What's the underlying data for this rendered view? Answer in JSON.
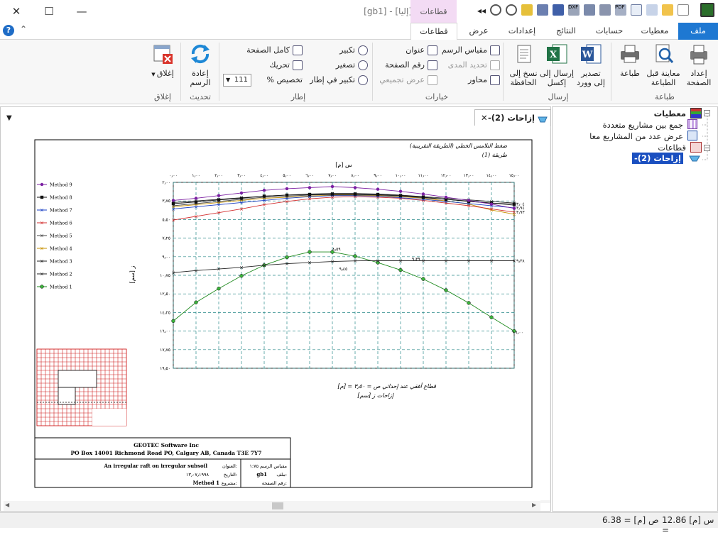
{
  "window": {
    "title": "[gb1] - [إليا]",
    "context_tab": "قطاعات"
  },
  "tabs": [
    {
      "id": "file",
      "label": "ملف"
    },
    {
      "id": "data",
      "label": "معطيات"
    },
    {
      "id": "calc",
      "label": "حسابات"
    },
    {
      "id": "results",
      "label": "النتائج"
    },
    {
      "id": "settings",
      "label": "إعدادات"
    },
    {
      "id": "view",
      "label": "عرض"
    },
    {
      "id": "sections",
      "label": "قطاعات"
    }
  ],
  "ribbon": {
    "print_group": {
      "label": "طباعة",
      "print_setup": "إعداد\nالصفحة",
      "print_preview": "معاينة قبل\nالطباعة",
      "print": "طباعة"
    },
    "send_group": {
      "label": "إرسال",
      "export_word": "تصدير\nإلى وورد",
      "send_excel": "إرسال إلى\nإكسل",
      "copy_clipboard": "نسخ إلى\nالحافظة"
    },
    "options_group": {
      "label": "خيارات",
      "scale": "مقياس الرسم",
      "title": "عنوان",
      "range": "تحديد المدى",
      "page_number": "رقم الصفحة",
      "axes": "محاور",
      "summary_view": "عرض تجميعي"
    },
    "frame_group": {
      "label": "إطار",
      "zoom_in": "تكبير",
      "full_page": "كامل الصفحة",
      "zoom_out": "تصغير",
      "pan": "تحريك",
      "zoom_window": "تكبير في إطار",
      "custom": "تخصيص %",
      "custom_value": "111"
    },
    "refresh_group": {
      "label": "تحديث",
      "redraw": "إعادة\nالرسم"
    },
    "close_group": {
      "label": "إغلاق",
      "close": "إغلاق"
    }
  },
  "document_tab": {
    "label": "إزاحات (2)-"
  },
  "tree": {
    "root": "معطيات",
    "items": [
      "جمع بين مشاريع متعددة",
      "عرض عدد من المشاريع معا"
    ],
    "sections": "قطاعات",
    "selected": "إزاحات (2)-"
  },
  "drawing": {
    "title_line1": "ضغط التلامس الخطي (الطريقة التقريبية)",
    "title_line2": "طريقة (1)",
    "x_axis_title": "س [م]",
    "y_axis_title": "ز [سم]",
    "footer_line1": "قطاع أفقي عند إحداثي ص = ٣٫٥٠ = [م]",
    "footer_line2": "إزاحات ز [سم]",
    "legend": [
      "Method 9",
      "Method 8",
      "Method 7",
      "Method 6",
      "Method 5",
      "Method 4",
      "Method 3",
      "Method 2",
      "Method 1"
    ],
    "company": "GEOTEC Software Inc",
    "address": "PO Box 14001 Richmond Road PO, Calgary AB, Canada T3E 7Y7",
    "project": "An irregular raft on irregular subsoil",
    "label_title": "العنوان:",
    "label_date": "التاريخ:",
    "date": "١٣٫٠٧٫١٩٩٨",
    "label_project": "مشروع:",
    "method": "Method 1",
    "label_scale": "مقياس الرسم ١:٧٥",
    "label_file": "ملف:",
    "file": "gb1",
    "label_page": "رقم الصفحة:"
  },
  "chart_data": {
    "type": "line",
    "x": [
      0,
      1,
      2,
      3,
      4,
      5,
      6,
      7,
      8,
      9,
      10,
      11,
      12,
      13,
      14,
      15
    ],
    "x_tick_labels": [
      "٠٫٠٠",
      "١٫٠٠",
      "٢٫٠٠",
      "٣٫٠٠",
      "٤٫٠٠",
      "٥٫٠٠",
      "٦٫٠٠",
      "٧٫٠٠",
      "٨٫٠٠",
      "٩٫٠٠",
      "١٠٫٠٠",
      "١١٫٠٠",
      "١٢٫٠٠",
      "١٣٫٠٠",
      "١٤٫٠٠",
      "١٥٫٠٠"
    ],
    "y_tick_labels": [
      "٢٫٠٠",
      "٣٫٧٥",
      "٥٫٥٠",
      "٧٫٢٥",
      "٩٫٠٠",
      "١٠٫٧٥",
      "١٢٫٥٠",
      "١٤٫٢٥",
      "١٦٫٠٠",
      "١٧٫٧٥",
      "١٩٫٥٠"
    ],
    "y_ticks": [
      2.0,
      3.75,
      5.5,
      7.25,
      9.0,
      10.75,
      12.5,
      14.25,
      16.0,
      17.75,
      19.5
    ],
    "ylim": [
      2.0,
      19.5
    ],
    "y_inverted": true,
    "series": [
      {
        "name": "Method 9",
        "color": "#7b1fa2",
        "values": [
          3.7,
          3.5,
          3.25,
          3.0,
          2.75,
          2.6,
          2.5,
          2.4,
          2.5,
          2.65,
          2.85,
          3.1,
          3.4,
          3.7,
          4.05,
          4.45
        ]
      },
      {
        "name": "Method 8",
        "color": "#111111",
        "values": [
          4.0,
          3.85,
          3.65,
          3.5,
          3.3,
          3.2,
          3.15,
          3.1,
          3.1,
          3.15,
          3.25,
          3.4,
          3.6,
          3.8,
          3.95,
          4.05
        ]
      },
      {
        "name": "Method 7",
        "color": "#1a3fc4",
        "values": [
          4.5,
          4.3,
          4.1,
          3.9,
          3.7,
          3.5,
          3.35,
          3.25,
          3.25,
          3.3,
          3.45,
          3.6,
          3.8,
          4.0,
          4.2,
          4.4
        ]
      },
      {
        "name": "Method 6",
        "color": "#d32f2f",
        "values": [
          5.55,
          5.2,
          4.85,
          4.5,
          4.1,
          3.8,
          3.55,
          3.4,
          3.35,
          3.4,
          3.5,
          3.7,
          3.95,
          4.2,
          4.5,
          4.8
        ]
      },
      {
        "name": "Method 5",
        "color": "#444444",
        "values": [
          4.2,
          4.0,
          3.8,
          3.6,
          3.4,
          3.3,
          3.2,
          3.15,
          3.15,
          3.2,
          3.3,
          3.45,
          3.6,
          3.75,
          3.95,
          4.15
        ]
      },
      {
        "name": "Method 4",
        "color": "#c79100",
        "values": [
          4.3,
          4.1,
          3.9,
          3.7,
          3.5,
          3.4,
          3.3,
          3.2,
          3.2,
          3.25,
          3.35,
          3.5,
          3.75,
          4.05,
          4.6,
          5.0
        ]
      },
      {
        "name": "Method 3",
        "color": "#222222",
        "values": [
          3.9,
          3.75,
          3.6,
          3.45,
          3.3,
          3.2,
          3.1,
          3.05,
          3.05,
          3.1,
          3.2,
          3.35,
          3.5,
          3.65,
          3.8,
          3.95
        ]
      },
      {
        "name": "Method 2",
        "color": "#222222",
        "values": [
          10.5,
          10.3,
          10.15,
          10.0,
          9.8,
          9.65,
          9.55,
          9.45,
          9.39,
          9.38,
          9.38,
          9.38,
          9.38,
          9.38,
          9.38,
          9.38
        ]
      },
      {
        "name": "Method 1",
        "color": "#1e8a1e",
        "values": [
          15.05,
          13.3,
          12.0,
          10.8,
          9.8,
          9.05,
          8.55,
          8.55,
          8.95,
          9.55,
          10.25,
          11.1,
          12.15,
          13.35,
          14.7,
          16.0
        ]
      }
    ],
    "data_labels": [
      "٣٫٠٤",
      "٣٫٩٤",
      "٣٫٩٣",
      "٩٫٣٨",
      "١٦٫٠٠",
      "٨٫٥٩",
      "٩٫٤٥",
      "٩٫٣٩"
    ]
  },
  "status": {
    "x_label": "س [م] =",
    "x_value": "12.86",
    "y_label": "ص [م] =",
    "y_value": "6.38"
  }
}
